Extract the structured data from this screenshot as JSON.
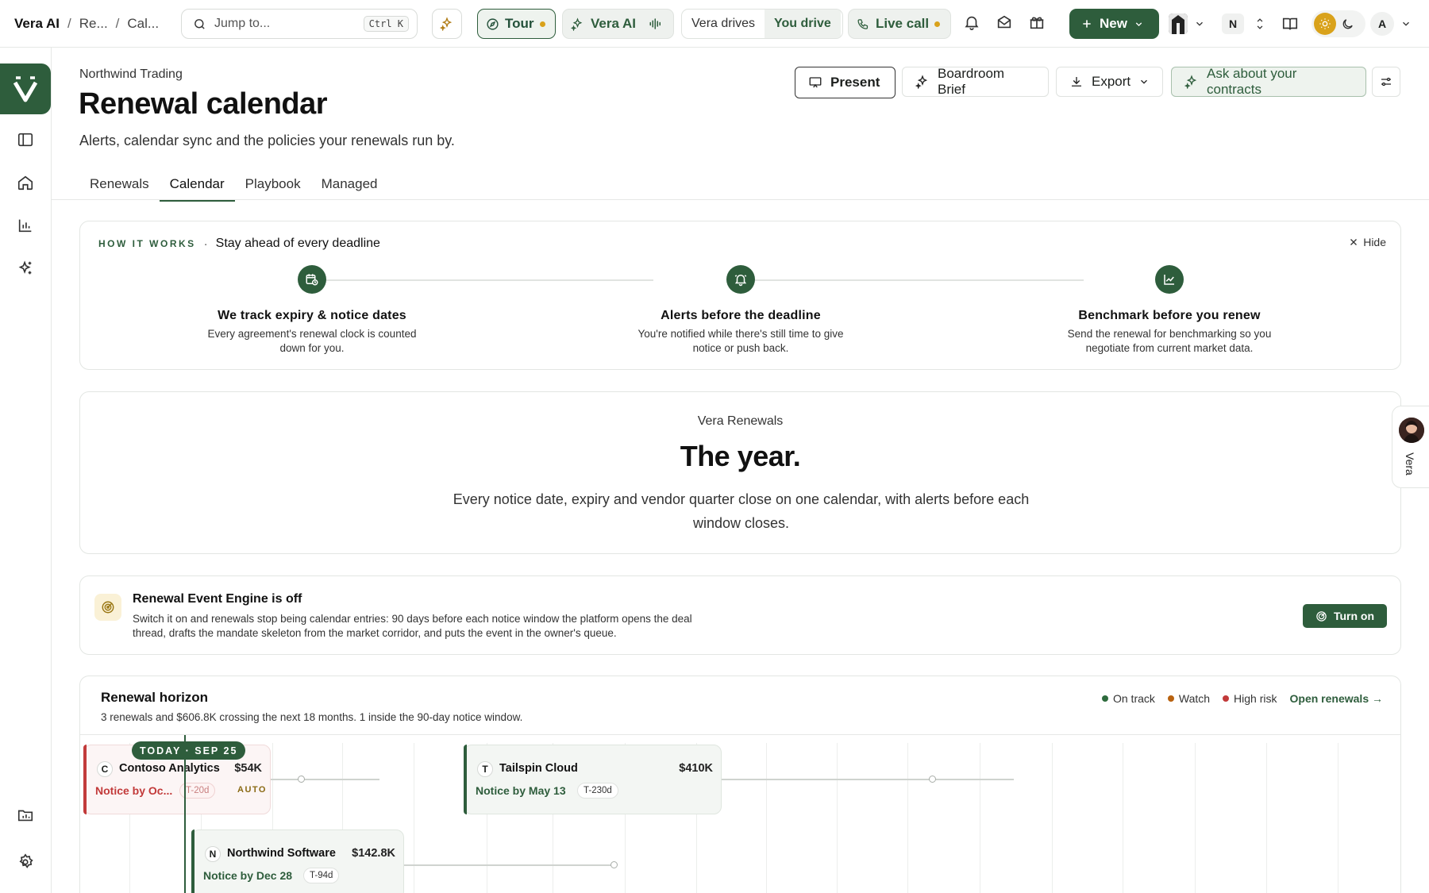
{
  "topbar": {
    "app": "Vera AI",
    "crumbs": [
      "Re...",
      "Cal..."
    ],
    "search_placeholder": "Jump to...",
    "search_shortcut": "Ctrl K",
    "tour_label": "Tour",
    "vera_label": "Vera AI",
    "vera_drives": "Vera drives",
    "you_drive": "You drive",
    "live_call": "Live call",
    "new_label": "New",
    "workspace_initial": "N",
    "user_initial": "A"
  },
  "header": {
    "org": "Northwind Trading",
    "title": "Renewal calendar",
    "subtitle": "Alerts, calendar sync and the policies your renewals run by.",
    "actions": {
      "present": "Present",
      "brief": "Boardroom Brief",
      "export": "Export",
      "ask": "Ask about your contracts"
    }
  },
  "tabs": [
    {
      "label": "Renewals",
      "active": false
    },
    {
      "label": "Calendar",
      "active": true
    },
    {
      "label": "Playbook",
      "active": false
    },
    {
      "label": "Managed",
      "active": false
    }
  ],
  "how_it_works": {
    "eyebrow": "HOW IT WORKS",
    "lead": "Stay ahead of every deadline",
    "hide": "Hide",
    "steps": [
      {
        "icon": "calendar-clock-icon",
        "title": "We track expiry & notice dates",
        "desc": "Every agreement's renewal clock is counted down for you."
      },
      {
        "icon": "bell-icon",
        "title": "Alerts before the deadline",
        "desc": "You're notified while there's still time to give notice or push back."
      },
      {
        "icon": "chart-line-icon",
        "title": "Benchmark before you renew",
        "desc": "Send the renewal for benchmarking so you negotiate from current market data."
      }
    ]
  },
  "year": {
    "kicker": "Vera Renewals",
    "headline": "The year.",
    "body": "Every notice date, expiry and vendor quarter close on one calendar, with alerts before each window closes."
  },
  "engine": {
    "title": "Renewal Event Engine is off",
    "desc": "Switch it on and renewals stop being calendar entries: 90 days before each notice window the platform opens the deal thread, drafts the mandate skeleton from the market corridor, and puts the event in the owner's queue.",
    "button": "Turn on"
  },
  "horizon": {
    "title": "Renewal horizon",
    "summary": "3 renewals and $606.8K crossing the next 18 months. 1 inside the 90-day notice window.",
    "legend": [
      {
        "label": "On track",
        "color": "#2e6b3d"
      },
      {
        "label": "Watch",
        "color": "#b8620f"
      },
      {
        "label": "High risk",
        "color": "#c23a3a"
      }
    ],
    "open_link": "Open renewals →",
    "today": "TODAY · SEP 25",
    "events": [
      {
        "initial": "C",
        "name": "Contoso Analytics",
        "amount": "$54K",
        "notice": "Notice by Oc...",
        "countdown": "T-20d",
        "auto": "AUTO",
        "status": "high"
      },
      {
        "initial": "T",
        "name": "Tailspin Cloud",
        "amount": "$410K",
        "notice": "Notice by May 13",
        "countdown": "T-230d",
        "status": "ok"
      },
      {
        "initial": "N",
        "name": "Northwind Software",
        "amount": "$142.8K",
        "notice": "Notice by Dec 28",
        "countdown": "T-94d",
        "status": "ok"
      }
    ]
  },
  "vera_tab": {
    "label": "Vera"
  },
  "colors": {
    "brand": "#2e5d3c",
    "accent_yellow": "#d9a21b",
    "risk": "#c23a3a"
  }
}
